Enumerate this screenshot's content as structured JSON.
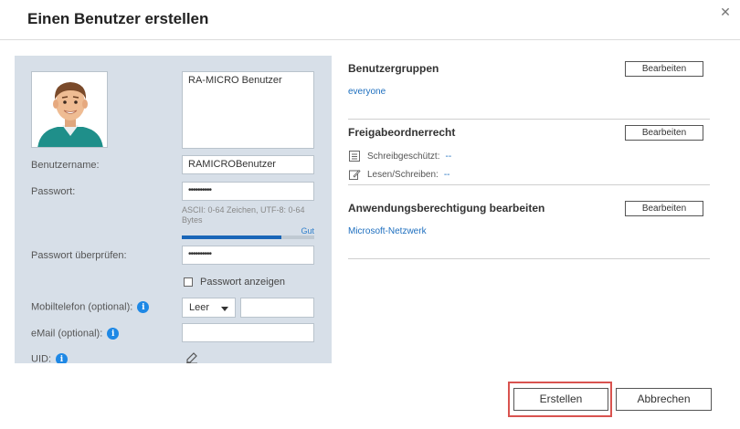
{
  "dialog": {
    "title": "Einen Benutzer erstellen",
    "close_symbol": "✕"
  },
  "user_form": {
    "description": "RA-MICRO Benutzer",
    "username_label": "Benutzername:",
    "username_value": "RAMICROBenutzer",
    "password_label": "Passwort:",
    "password_value": "••••••••••",
    "password_hint": "ASCII: 0-64 Zeichen, UTF-8: 0-64 Bytes",
    "password_strength_label": "Gut",
    "password_strength": 0.75,
    "confirm_label": "Passwort überprüfen:",
    "confirm_value": "••••••••••",
    "show_password_label": "Passwort anzeigen",
    "show_password_checked": false,
    "mobile_label": "Mobiltelefon (optional):",
    "mobile_select_value": "Leer",
    "mobile_value": "",
    "email_label": "eMail (optional):",
    "email_value": "",
    "uid_label": "UID:",
    "info_symbol": "i"
  },
  "groups": {
    "title": "Benutzergruppen",
    "edit_label": "Bearbeiten",
    "items": [
      "everyone"
    ]
  },
  "share": {
    "title": "Freigabeordnerrecht",
    "edit_label": "Bearbeiten",
    "readonly_label": "Schreibgeschützt:",
    "readonly_value": "--",
    "readwrite_label": "Lesen/Schreiben:",
    "readwrite_value": "--"
  },
  "apps": {
    "title": "Anwendungsberechtigung bearbeiten",
    "edit_label": "Bearbeiten",
    "items": [
      "Microsoft-Netzwerk"
    ]
  },
  "footer": {
    "create_label": "Erstellen",
    "cancel_label": "Abbrechen",
    "highlight_color": "#d9534f"
  },
  "icons": {
    "avatar": "user-avatar",
    "info": "info-icon",
    "edit": "pencil-edit-icon",
    "readonly": "document-lines-icon",
    "readwrite": "pencil-document-icon",
    "dropdown": "chevron-down-icon"
  },
  "colors": {
    "panel_bg": "#d7dfe8",
    "link": "#1e6fbf",
    "info": "#1e88e5",
    "strength": "#1a66b8"
  }
}
